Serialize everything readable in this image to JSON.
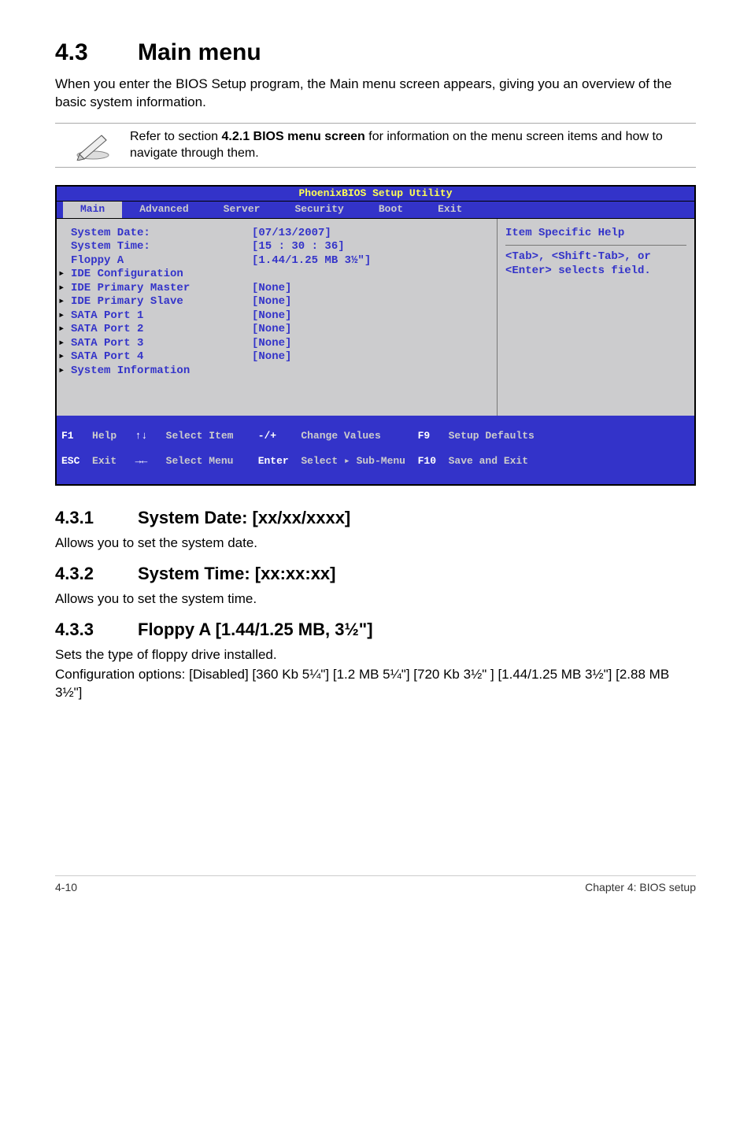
{
  "heading": {
    "number": "4.3",
    "title": "Main menu"
  },
  "intro": "When you enter the BIOS Setup program, the Main menu screen appears, giving you an overview of the basic system information.",
  "note": {
    "text_before_bold": "Refer to section ",
    "bold": "4.2.1 BIOS menu screen",
    "text_after_bold": " for information on the menu screen items and how to navigate through them."
  },
  "bios": {
    "title": "PhoenixBIOS Setup Utility",
    "tabs": [
      "Main",
      "Advanced",
      "Server",
      "Security",
      "Boot",
      "Exit"
    ],
    "active_tab": "Main",
    "rows": [
      {
        "arrow": "",
        "label": "System Date:",
        "value": "[07/13/2007]"
      },
      {
        "arrow": "",
        "label": "System Time:",
        "value": "[15 : 30 : 36]"
      },
      {
        "arrow": "",
        "label": "",
        "value": ""
      },
      {
        "arrow": "",
        "label": "Floppy A",
        "value": "[1.44/1.25 MB 3½\"]"
      },
      {
        "arrow": "",
        "label": "",
        "value": ""
      },
      {
        "arrow": "▸",
        "label": "IDE Configuration",
        "value": ""
      },
      {
        "arrow": "▸",
        "label": "IDE Primary Master",
        "value": "[None]"
      },
      {
        "arrow": "▸",
        "label": "IDE Primary Slave",
        "value": "[None]"
      },
      {
        "arrow": "▸",
        "label": "SATA Port 1",
        "value": "[None]"
      },
      {
        "arrow": "▸",
        "label": "SATA Port 2",
        "value": "[None]"
      },
      {
        "arrow": "▸",
        "label": "SATA Port 3",
        "value": "[None]"
      },
      {
        "arrow": "▸",
        "label": "SATA Port 4",
        "value": "[None]"
      },
      {
        "arrow": "",
        "label": "",
        "value": ""
      },
      {
        "arrow": "▸",
        "label": "System Information",
        "value": ""
      }
    ],
    "help_title": "Item Specific Help",
    "help_body": "<Tab>, <Shift-Tab>, or <Enter> selects field.",
    "footer": {
      "c1a": "F1",
      "c1b": "Help",
      "c2a": "↑↓",
      "c2b": "Select Item",
      "c3a": "-/+",
      "c3b": "Change Values",
      "c4a": "F9",
      "c4b": "Setup Defaults",
      "r2c1a": "ESC",
      "r2c1b": "Exit",
      "r2c2a": "→←",
      "r2c2b": "Select Menu",
      "r2c3a": "Enter",
      "r2c3b": "Select ▸ Sub-Menu",
      "r2c4a": "F10",
      "r2c4b": "Save and Exit"
    }
  },
  "sub": [
    {
      "num": "4.3.1",
      "title": "System Date: [xx/xx/xxxx]",
      "body": "Allows you to set the system date."
    },
    {
      "num": "4.3.2",
      "title": "System Time: [xx:xx:xx]",
      "body": "Allows you to set the system time."
    },
    {
      "num": "4.3.3",
      "title": "Floppy A [1.44/1.25 MB, 3½\"]",
      "body1": "Sets the type of floppy drive installed.",
      "body2": "Configuration options: [Disabled] [360 Kb  5¼\"] [1.2 MB  5¼\"] [720 Kb  3½\" ] [1.44/1.25 MB  3½\"] [2.88 MB  3½\"]"
    }
  ],
  "page_footer": {
    "left": "4-10",
    "right": "Chapter 4: BIOS setup"
  }
}
